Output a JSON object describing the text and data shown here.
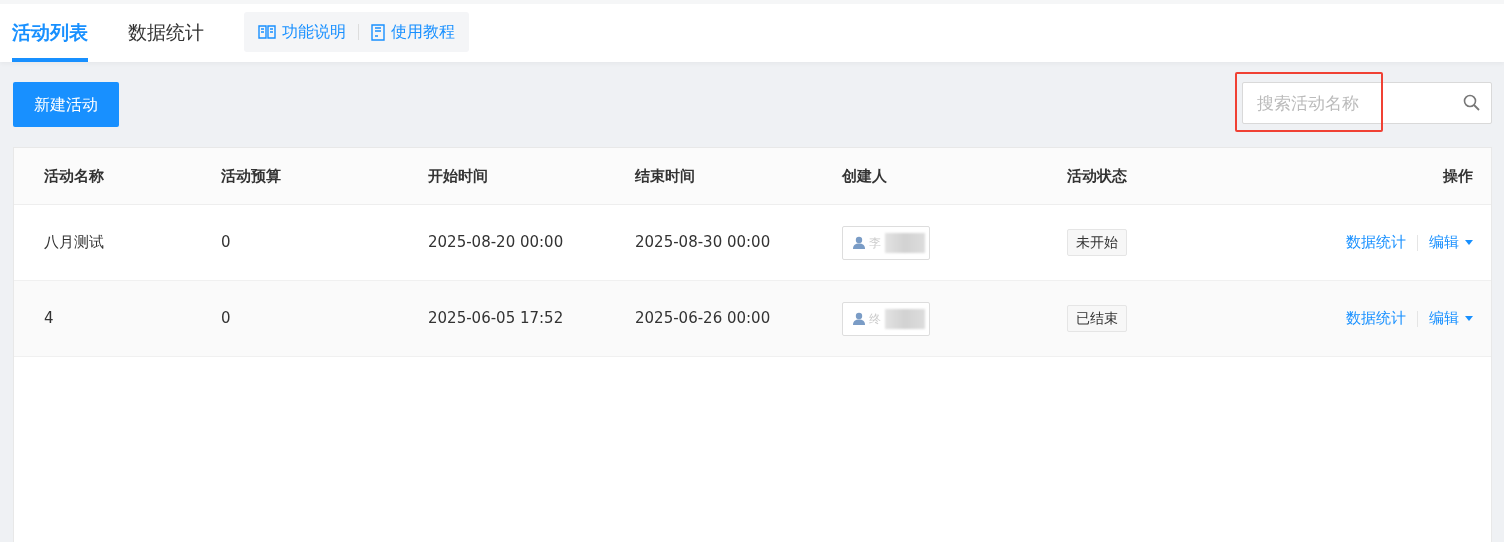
{
  "tabs": [
    {
      "label": "活动列表",
      "selected": true
    },
    {
      "label": "数据统计",
      "selected": false
    }
  ],
  "help_links": [
    {
      "label": "功能说明",
      "kind": "book"
    },
    {
      "label": "使用教程",
      "kind": "doc"
    }
  ],
  "create_button": "新建活动",
  "search": {
    "placeholder": "搜索活动名称",
    "highlighted": true
  },
  "table": {
    "columns": [
      "活动名称",
      "活动预算",
      "开始时间",
      "结束时间",
      "创建人",
      "活动状态",
      "操作"
    ],
    "rows": [
      {
        "name": "八月测试",
        "budget": "0",
        "start": "2025-08-20 00:00",
        "end": "2025-08-30 00:00",
        "creator_initial": "李",
        "status": "未开始",
        "actions": [
          "数据统计",
          "编辑"
        ]
      },
      {
        "name": "4",
        "budget": "0",
        "start": "2025-06-05 17:52",
        "end": "2025-06-26 00:00",
        "creator_initial": "终",
        "status": "已结束",
        "actions": [
          "数据统计",
          "编辑"
        ]
      }
    ]
  }
}
